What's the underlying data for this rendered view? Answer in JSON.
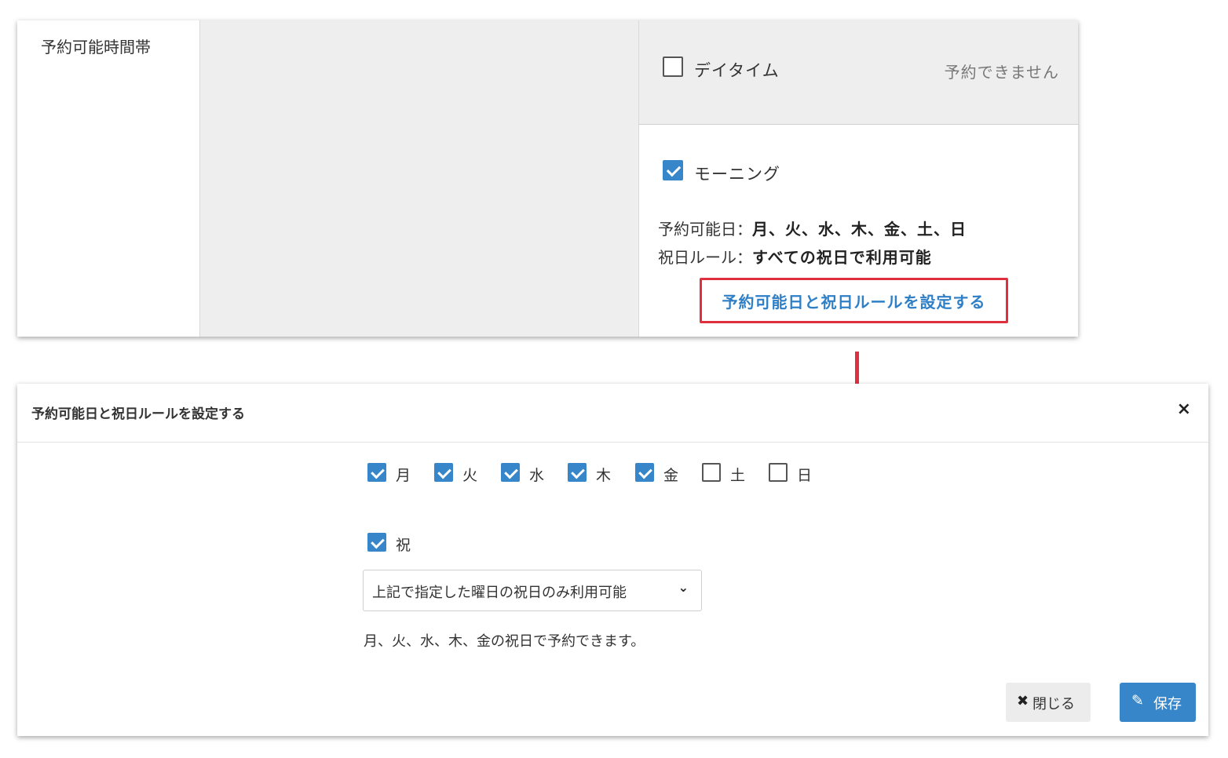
{
  "settings_card": {
    "row_label": "予約可能時間帯",
    "daytime": {
      "name": "デイタイム",
      "checked": false,
      "status": "予約できません"
    },
    "morning": {
      "name": "モーニング",
      "checked": true,
      "available_days_label": "予約可能日：",
      "available_days_value": "月、火、水、木、金、土、日",
      "holiday_rule_label": "祝日ルール：",
      "holiday_rule_value": "すべての祝日で利用可能",
      "settings_link": "予約可能日と祝日ルールを設定する"
    }
  },
  "modal": {
    "title": "予約可能日と祝日ルールを設定する",
    "close_symbol": "×",
    "days": [
      {
        "label": "月",
        "checked": true
      },
      {
        "label": "火",
        "checked": true
      },
      {
        "label": "水",
        "checked": true
      },
      {
        "label": "木",
        "checked": true
      },
      {
        "label": "金",
        "checked": true
      },
      {
        "label": "土",
        "checked": false
      },
      {
        "label": "日",
        "checked": false
      }
    ],
    "holiday": {
      "label": "祝",
      "checked": true
    },
    "holiday_rule_select": {
      "value": "上記で指定した曜日の祝日のみ利用可能"
    },
    "note": "月、火、水、木、金の祝日で予約できます。",
    "buttons": {
      "close_label": "閉じる",
      "save_label": "保存"
    }
  },
  "colors": {
    "accent": "#3686c9",
    "highlight": "#e03040",
    "panel_bg": "#eeeeee"
  },
  "icons": {
    "close_button_icon": "times-icon",
    "save_button_icon": "edit-icon",
    "select_icon": "chevron-down-icon",
    "arrow": "arrow-down-icon"
  }
}
